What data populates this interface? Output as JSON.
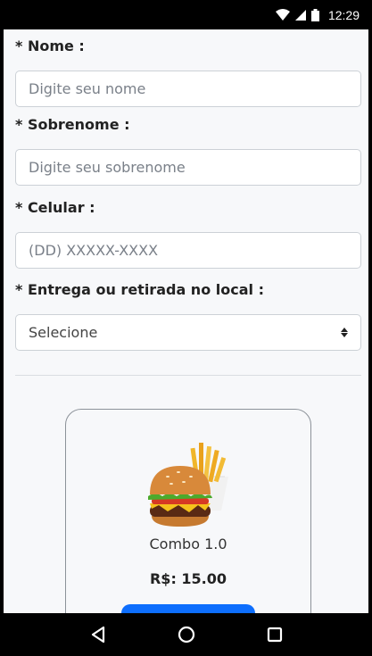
{
  "status_bar": {
    "time": "12:29"
  },
  "form": {
    "first_name": {
      "label": "* Nome :",
      "placeholder": "Digite seu nome"
    },
    "last_name": {
      "label": "* Sobrenome :",
      "placeholder": "Digite seu sobrenome"
    },
    "phone": {
      "label": "* Celular :",
      "placeholder": "(DD) XXXXX-XXXX"
    },
    "delivery": {
      "label": "* Entrega ou retirada no local :",
      "selected": "Selecione"
    }
  },
  "product": {
    "name": "Combo 1.0",
    "price": "R$: 15.00"
  },
  "colors": {
    "primary": "#0d6efd",
    "background": "#f7f8fa"
  }
}
